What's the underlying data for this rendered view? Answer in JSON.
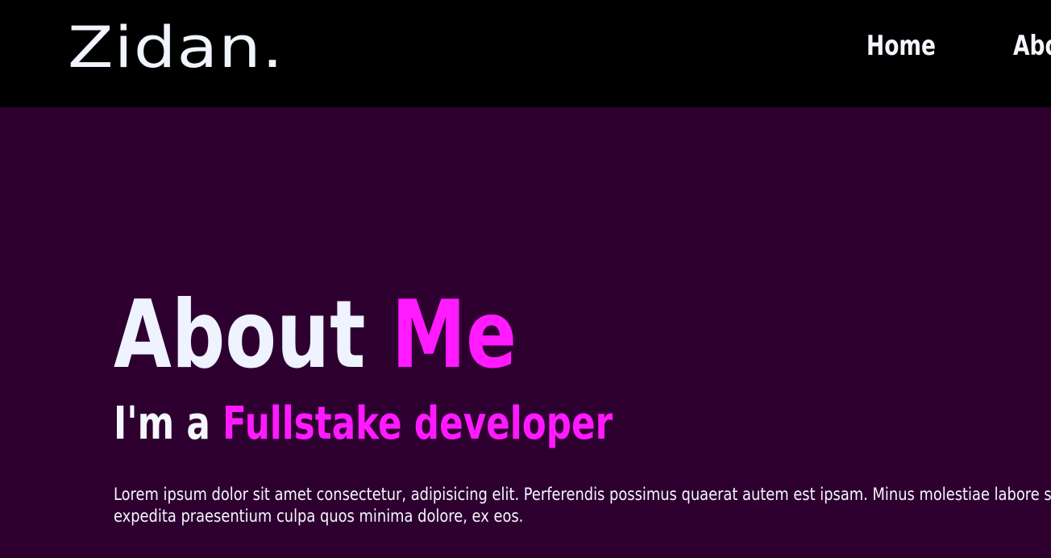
{
  "header": {
    "logo": "Zidan.",
    "nav": {
      "home": "Home",
      "about": "About"
    }
  },
  "hero": {
    "title_main": "About ",
    "title_accent": "Me",
    "subtitle_main": "I'm a ",
    "subtitle_accent": "Fullstake developer",
    "paragraph": "Lorem ipsum dolor sit amet consectetur, adipisicing elit. Perferendis possimus quaerat autem est ipsam. Minus molestiae labore sed ratione expedita praesentium culpa quos minima dolore, ex eos."
  },
  "colors": {
    "header_bg": "#000000",
    "page_bg": "#2e0030",
    "accent": "#ff1aff",
    "text": "#f5f7ff"
  }
}
